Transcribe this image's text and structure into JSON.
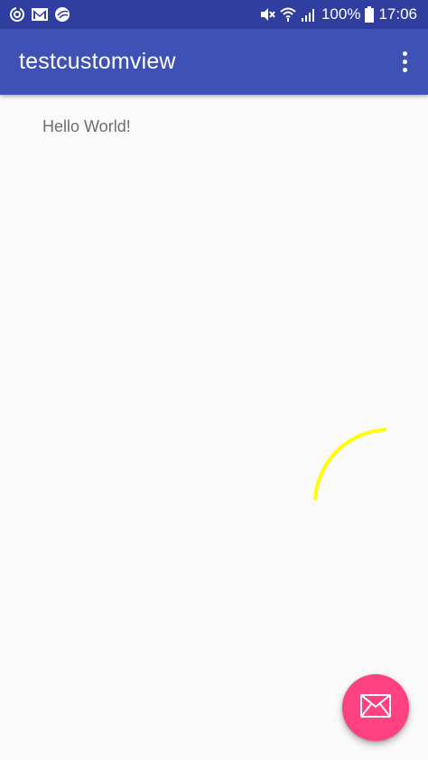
{
  "status_bar": {
    "battery_percent": "100%",
    "time": "17:06",
    "left_icons": [
      "sync-icon",
      "gmail-icon",
      "weather-icon"
    ],
    "right_icons": [
      "mute-icon",
      "wifi-icon",
      "signal-icon",
      "battery-icon"
    ]
  },
  "app_bar": {
    "title": "testcustomview",
    "menu_icon": "more-vert-icon"
  },
  "content": {
    "hello_text": "Hello World!",
    "custom_view": {
      "shape": "arc",
      "color": "#ffff00"
    }
  },
  "fab": {
    "icon": "email-icon",
    "color": "#ff4081"
  },
  "colors": {
    "status_bar": "#303f9f",
    "app_bar": "#3f51b5",
    "background": "#fafafa",
    "accent": "#ff4081"
  }
}
